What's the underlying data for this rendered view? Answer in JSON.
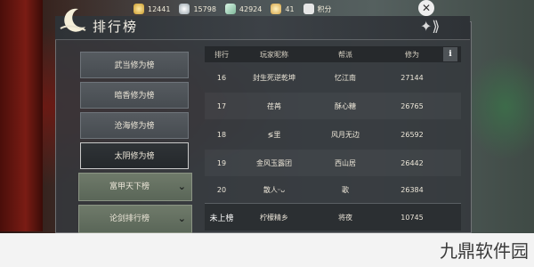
{
  "topbar": {
    "resources": [
      {
        "icon": "gold-ingot-icon",
        "value": "12441"
      },
      {
        "icon": "silver-icon",
        "value": "15798"
      },
      {
        "icon": "jade-icon",
        "value": "42924"
      },
      {
        "icon": "coin-icon",
        "value": "41"
      },
      {
        "icon": "bag-icon",
        "value": "积分"
      }
    ]
  },
  "panel": {
    "title": "排行榜"
  },
  "menu": {
    "items": [
      {
        "label": "武当修为榜",
        "active": false
      },
      {
        "label": "暗香修为榜",
        "active": false
      },
      {
        "label": "沧海修为榜",
        "active": false
      },
      {
        "label": "太阴修为榜",
        "active": true
      }
    ],
    "sub_items": [
      {
        "label": "富甲天下榜"
      },
      {
        "label": "论剑排行榜"
      }
    ]
  },
  "table": {
    "headers": [
      "排行",
      "玩家昵称",
      "帮派",
      "修为"
    ],
    "rows": [
      [
        "16",
        "封生死逆乾坤",
        "忆江南",
        "27144"
      ],
      [
        "17",
        "荏苒",
        "酥心糖",
        "26765"
      ],
      [
        "18",
        "≶里",
        "风月无边",
        "26592"
      ],
      [
        "19",
        "金风玉露团",
        "西山居",
        "26442"
      ],
      [
        "20",
        "散人ᵕᴗ",
        "歌",
        "26384"
      ]
    ],
    "self_row": [
      "未上榜",
      "柠檬精乡",
      "将夜",
      "10745"
    ]
  },
  "watermark": "九鼎软件园",
  "colors": {
    "panel_bg": "#34383c",
    "accent_red": "#7a1c14",
    "sub_button": "#6f7a6a"
  }
}
